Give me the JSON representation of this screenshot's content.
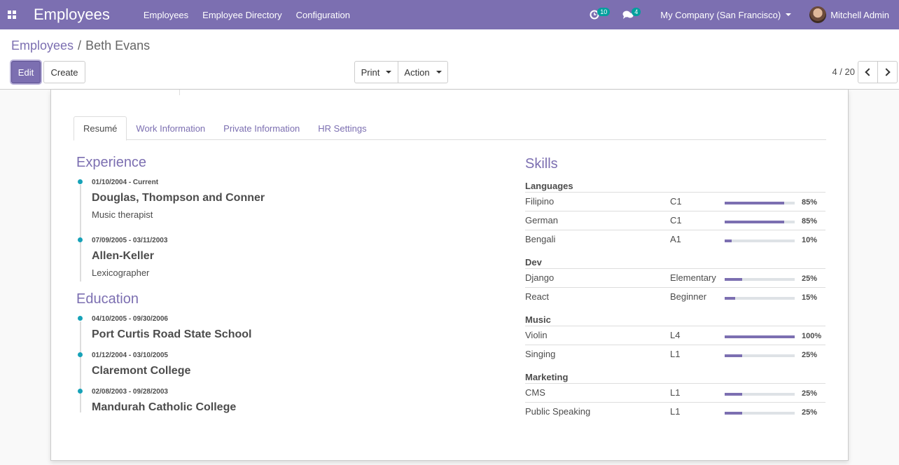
{
  "navbar": {
    "app_title": "Employees",
    "menu": [
      "Employees",
      "Employee Directory",
      "Configuration"
    ],
    "activity_count": "10",
    "message_count": "4",
    "company": "My Company (San Francisco)",
    "user": "Mitchell Admin"
  },
  "breadcrumb": {
    "parent": "Employees",
    "separator": "/",
    "current": "Beth Evans"
  },
  "buttons": {
    "edit": "Edit",
    "create": "Create",
    "print": "Print",
    "action": "Action"
  },
  "pager": {
    "value": "4 / 20"
  },
  "tabs": [
    "Resumé",
    "Work Information",
    "Private Information",
    "HR Settings"
  ],
  "resume": {
    "experience_title": "Experience",
    "experience": [
      {
        "date": "01/10/2004 - Current",
        "name": "Douglas, Thompson and Conner",
        "description": "Music therapist"
      },
      {
        "date": "07/09/2005 - 03/11/2003",
        "name": "Allen-Keller",
        "description": "Lexicographer"
      }
    ],
    "education_title": "Education",
    "education": [
      {
        "date": "04/10/2005 - 09/30/2006",
        "name": "Port Curtis Road State School"
      },
      {
        "date": "01/12/2004 - 03/10/2005",
        "name": "Claremont College"
      },
      {
        "date": "02/08/2003 - 09/28/2003",
        "name": "Mandurah Catholic College"
      }
    ]
  },
  "skills": {
    "title": "Skills",
    "groups": [
      {
        "name": "Languages",
        "items": [
          {
            "name": "Filipino",
            "level": "C1",
            "progress": 85,
            "label": "85%"
          },
          {
            "name": "German",
            "level": "C1",
            "progress": 85,
            "label": "85%"
          },
          {
            "name": "Bengali",
            "level": "A1",
            "progress": 10,
            "label": "10%"
          }
        ]
      },
      {
        "name": "Dev",
        "items": [
          {
            "name": "Django",
            "level": "Elementary",
            "progress": 25,
            "label": "25%"
          },
          {
            "name": "React",
            "level": "Beginner",
            "progress": 15,
            "label": "15%"
          }
        ]
      },
      {
        "name": "Music",
        "items": [
          {
            "name": "Violin",
            "level": "L4",
            "progress": 100,
            "label": "100%"
          },
          {
            "name": "Singing",
            "level": "L1",
            "progress": 25,
            "label": "25%"
          }
        ]
      },
      {
        "name": "Marketing",
        "items": [
          {
            "name": "CMS",
            "level": "L1",
            "progress": 25,
            "label": "25%"
          },
          {
            "name": "Public Speaking",
            "level": "L1",
            "progress": 25,
            "label": "25%"
          }
        ]
      }
    ]
  },
  "colors": {
    "brand": "#7c6fb1",
    "timeline_dot": "#17a2b8",
    "badge": "#00a09d"
  }
}
